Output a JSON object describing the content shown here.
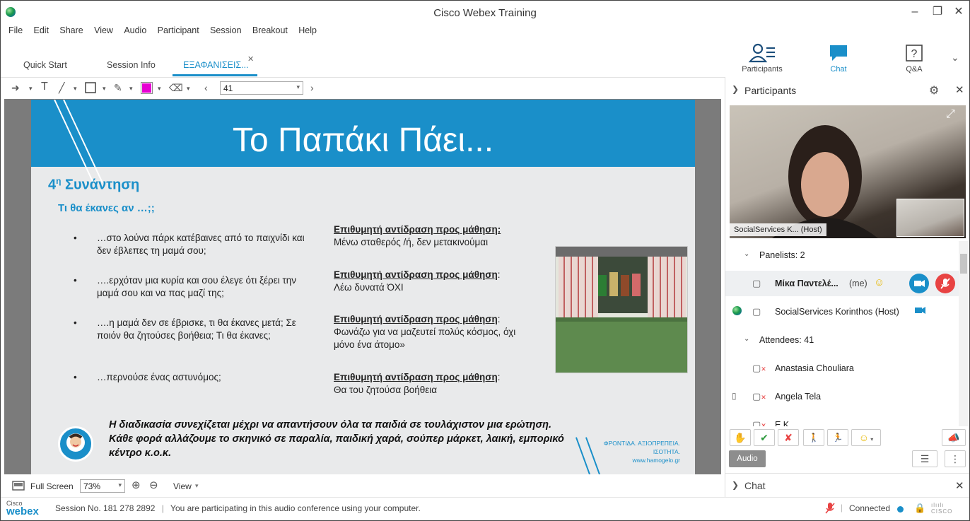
{
  "window": {
    "title": "Cisco Webex Training"
  },
  "menu": [
    "File",
    "Edit",
    "Share",
    "View",
    "Audio",
    "Participant",
    "Session",
    "Breakout",
    "Help"
  ],
  "tabs": [
    {
      "label": "Quick Start"
    },
    {
      "label": "Session Info"
    },
    {
      "label": "ΕΞΑΦΑΝΙΣΕΙΣ..."
    }
  ],
  "top_right": {
    "participants": "Participants",
    "chat": "Chat",
    "qa": "Q&A"
  },
  "toolbar": {
    "page": "41",
    "fill_color": "#e600d2"
  },
  "slide": {
    "title": "Το Παπάκι Πάει...",
    "meeting_num": "4",
    "meeting_sup": "η",
    "meeting_word": "Συνάντηση",
    "question": "Τι θα έκανες αν …;;",
    "bullets": [
      {
        "text": "…στο λούνα πάρκ κατέβαινες από το παιχνίδι και δεν έβλεπες τη μαμά σου;"
      },
      {
        "text": "….ερχόταν μια κυρία και σου έλεγε ότι ξέρει την μαμά σου και να πας μαζί της;"
      },
      {
        "text": "….η μαμά δεν σε έβρισκε, τι θα έκανες μετά; Σε ποιόν θα ζητούσες βοήθεια; Τι θα έκανες;"
      },
      {
        "text": "…περνούσε ένας αστυνόμος;"
      }
    ],
    "responses": [
      {
        "heading": "Επιθυμητή αντίδραση προς μάθηση:",
        "text": "Μένω σταθερός /ή, δεν μετακινούμαι"
      },
      {
        "heading": "Επιθυμητή αντίδραση προς μάθηση",
        "text": "Λέω δυνατά ΌΧΙ"
      },
      {
        "heading": "Επιθυμητή αντίδραση προς μάθηση",
        "text": "Φωνάζω για να μαζευτεί πολύς κόσμος, όχι μόνο ένα άτομο»"
      },
      {
        "heading": "Επιθυμητή αντίδραση προς μάθηση",
        "text": "Θα του ζητούσα βοήθεια"
      }
    ],
    "footnote": "Η διαδικασία συνεχίζεται μέχρι να απαντήσουν όλα τα παιδιά σε τουλάχιστον μια ερώτηση. Κάθε φορά αλλάζουμε το σκηνικό σε παραλία, παιδική χαρά, σούπερ μάρκετ, λαική, εμπορικό κέντρο κ.ο.κ.",
    "brand_line1": "ΦΡΟΝΤΙΔΑ. ΑΞΙΟΠΡΕΠΕΙΑ. ΙΣΟΤΗΤΑ.",
    "brand_line2": "www.hamogelo.gr"
  },
  "viewbar": {
    "fullscreen": "Full Screen",
    "zoom": "73%",
    "view": "View"
  },
  "status": {
    "session": "Session No. 181 278 2892",
    "audio_msg": "You are participating in this audio conference using your computer.",
    "connection": "Connected",
    "cisco": "Cisco",
    "webex": "webex"
  },
  "panel": {
    "title": "Participants",
    "video_label": "SocialServices K... (Host)",
    "panelists_label": "Panelists: 2",
    "me_name": "Μίκα Παντελέ...",
    "me_suffix": "(me)",
    "host_name": "SocialServices Korinthos (Host)",
    "attendees_label": "Attendees: 41",
    "attendees": [
      "Anastasia Chouliara",
      "Angela Tela",
      "E.K."
    ],
    "audio_button": "Audio",
    "chat_label": "Chat"
  },
  "colors": {
    "accent": "#1a8fc9",
    "mute_red": "#e84343"
  }
}
